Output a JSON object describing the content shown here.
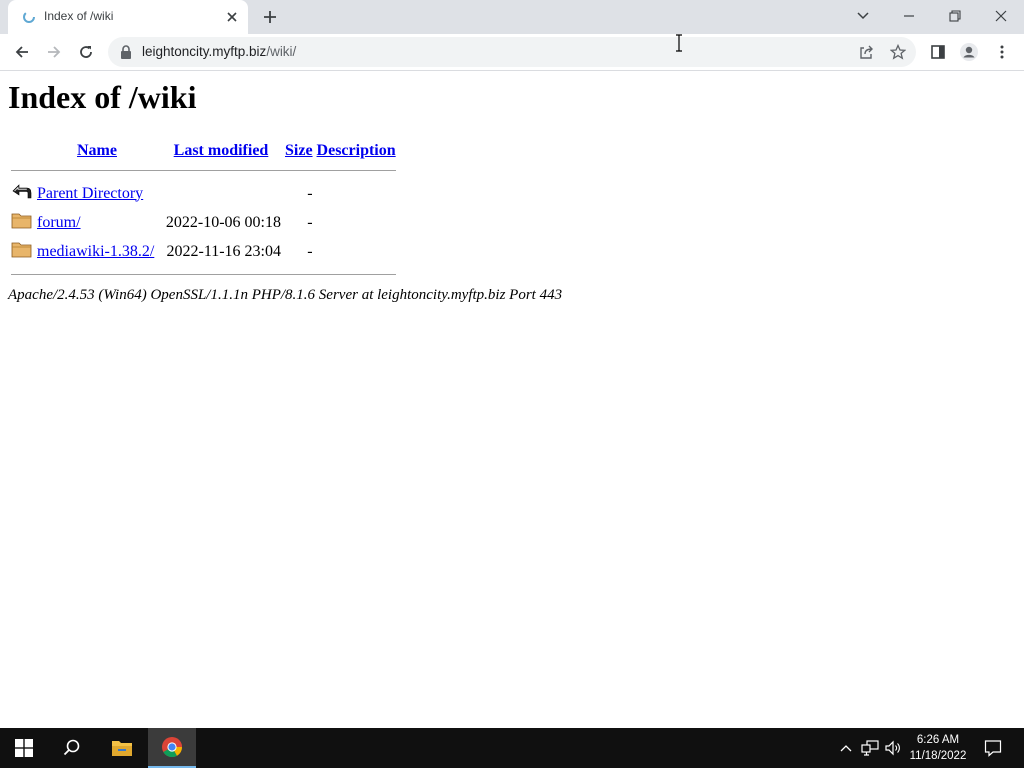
{
  "browser": {
    "tab": {
      "title": "Index of /wiki"
    },
    "url": {
      "host": "leightoncity.myftp.biz",
      "path": "/wiki/"
    }
  },
  "page": {
    "heading": "Index of /wiki",
    "columns": {
      "name": "Name",
      "last_modified": "Last modified",
      "size": "Size",
      "description": "Description"
    },
    "rows": [
      {
        "icon": "parent-directory-icon",
        "name": "Parent Directory",
        "last_modified": "",
        "size": "-",
        "description": ""
      },
      {
        "icon": "folder-icon",
        "name": "forum/",
        "last_modified": "2022-10-06 00:18",
        "size": "-",
        "description": ""
      },
      {
        "icon": "folder-icon",
        "name": "mediawiki-1.38.2/",
        "last_modified": "2022-11-16 23:04",
        "size": "-",
        "description": ""
      }
    ],
    "footer": "Apache/2.4.53 (Win64) OpenSSL/1.1.1n PHP/8.1.6 Server at leightoncity.myftp.biz Port 443"
  },
  "taskbar": {
    "time": "6:26 AM",
    "date": "11/18/2022"
  },
  "colors": {
    "link": "#0000ee",
    "tabstrip": "#dee1e6",
    "taskbar": "#101010",
    "folder": "#e8b56a"
  }
}
